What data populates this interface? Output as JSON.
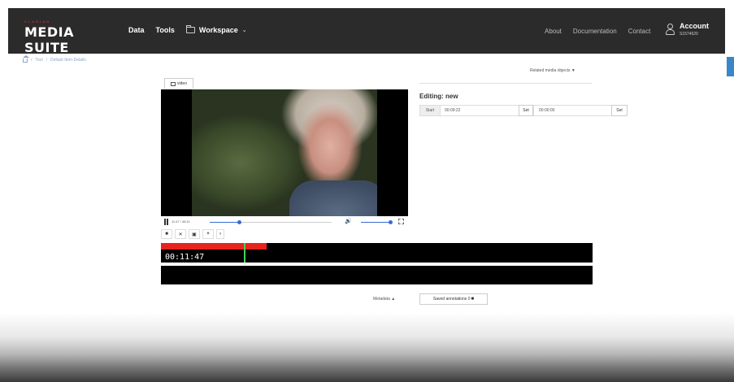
{
  "navbar": {
    "brand_pre": "CLARIAH",
    "brand_name": "MEDIA SUITE",
    "links": {
      "data": "Data",
      "tools": "Tools",
      "workspace": "Workspace"
    },
    "right_links": {
      "about": "About",
      "documentation": "Documentation",
      "contact": "Contact"
    },
    "account": {
      "title": "Account",
      "id": "S1574620"
    },
    "icons": {
      "workspace": "folder-icon",
      "workspace_chevron": "chevron-down-icon",
      "account": "user-icon"
    }
  },
  "breadcrumb": {
    "tool": "Tool",
    "page": "Default Item-Details",
    "separator": "/"
  },
  "related_media": "Related media objects ▼",
  "player": {
    "tab_label": "video",
    "time_display": "11:47 / 48:11",
    "progress_fraction": 0.24,
    "volume_fraction": 1.0,
    "icons": [
      "play-pause-icon",
      "volume-icon",
      "fullscreen-icon"
    ]
  },
  "annotation_toolbar": {
    "buttons": [
      {
        "name": "comment-button",
        "glyph": "■"
      },
      {
        "name": "delete-button",
        "glyph": "✕"
      },
      {
        "name": "save-button",
        "glyph": "▣"
      },
      {
        "name": "add-button",
        "glyph": "+"
      },
      {
        "name": "more-button",
        "glyph": "›"
      }
    ]
  },
  "timeline": {
    "current_time": "00:11:47",
    "segment_start_fraction": 0.0,
    "segment_end_fraction": 0.245,
    "cursor_fraction": 0.193
  },
  "editing": {
    "title": "Editing: new",
    "start_label": "Start",
    "start_value": "00:09:22",
    "set_label": "Set",
    "end_value": "00:00:00"
  },
  "bottom_tabs": {
    "metadata": "Metadata ▲",
    "saved_annotations": "Saved annotations 0"
  },
  "colors": {
    "navbar_bg": "#2b2b2b",
    "accent_blue": "#3a6bd4",
    "segment_red": "#e8231e",
    "cursor_green": "#44d45a",
    "brand_red": "#b33333"
  }
}
